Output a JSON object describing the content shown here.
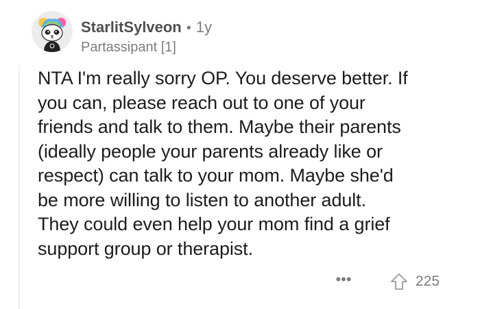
{
  "comment": {
    "author": "StarlitSylveon",
    "separator": "•",
    "age": "1y",
    "flair": "Partassipant [1]",
    "body_lines": [
      "NTA I'm really sorry OP. You deserve better. If",
      "you can, please reach out to one of your",
      "friends and talk to them. Maybe their parents",
      "(ideally people your parents already like or",
      "respect) can talk to your mom. Maybe she'd",
      "be more willing to listen to another adult.",
      "They could even help your mom find a grief",
      "support group or therapist."
    ],
    "more_label": "•••",
    "upvote_count": "225"
  },
  "icons": {
    "avatar": "panda-avatar",
    "more": "more-options-icon",
    "upvote": "upvote-arrow-icon"
  },
  "colors": {
    "text_primary": "#1c1c1c",
    "text_secondary": "#7c7c7c",
    "username": "#4f4f4f",
    "thread_line": "#eeeeee",
    "background": "#ffffff"
  }
}
